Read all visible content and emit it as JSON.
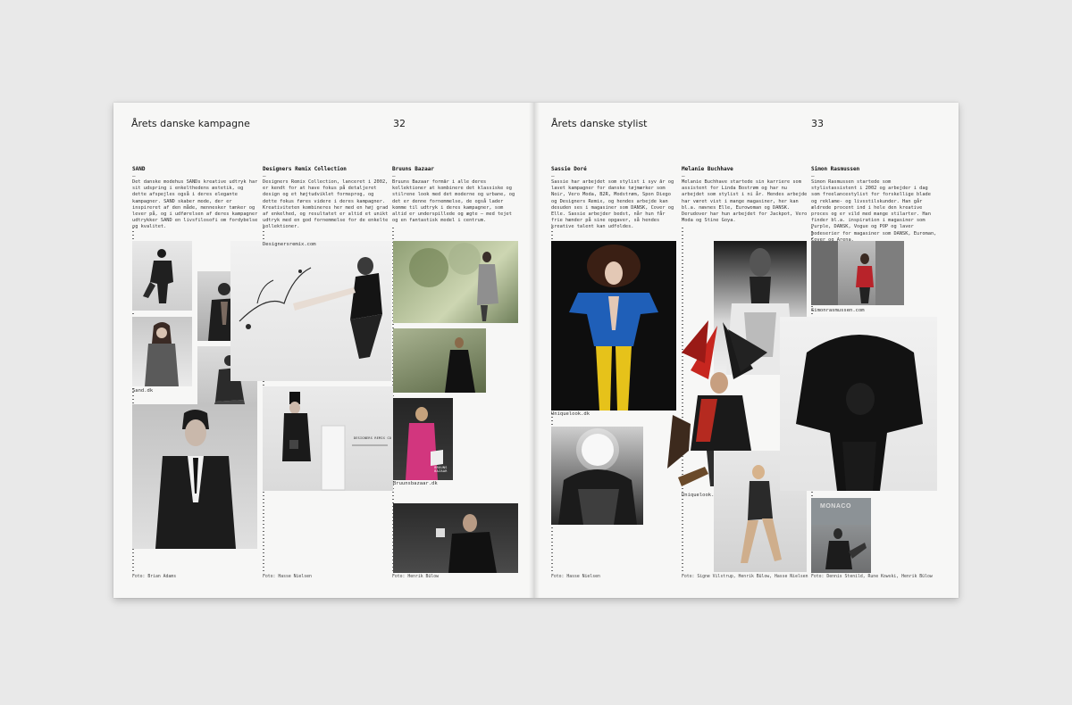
{
  "left_page": {
    "title": "Årets danske kampagne",
    "number": "32",
    "columns": [
      {
        "heading": "SAND",
        "body": "Det danske modehus SANDs kreative udtryk har sit udspring i enkelthedens æstetik, og dette afspejles også i deres elegante kampagner. SAND skaber mode, der er inspireret af den måde, mennesker tænker og lever på, og i udførelsen af deres kampagner udtrykker SAND en livsfilosofi om fordybelse og kvalitet."
      },
      {
        "heading": "Designers Remix Collection",
        "body": "Designers Remix Collection, lanceret i 2002, er kendt for at have fokus på detaljeret design og et højtudviklet formsprog, og dette fokus føres videre i deres kampagner. Kreativiteten kombineres her med en høj grad af enkelhed, og resultatet er altid et unikt udtryk med en god fornemmelse for de enkelte kollektioner."
      },
      {
        "heading": "Bruuns Bazaar",
        "body": "Bruuns Bazaar formår i alle deres kollektioner at kombinere det klassiske og stilrene look med det moderne og urbane, og det er denne fornemmelse, de også lader komme til udtryk i deres kampagner, som altid er underspillede og ægte – med tejet og en fantastisk model i centrum."
      }
    ],
    "captions": {
      "sand": "Sand.dk",
      "remix": "Designersremix.com",
      "bruuns": "Bruunsbazaar.dk"
    },
    "credits": [
      "Foto: Brian Adams",
      "Foto: Hasse Nielsen",
      "Foto: Henrik Bülow"
    ],
    "logo_texts": {
      "remix_store": "DESIGNERS REMIX CO",
      "bruuns_logo": "BRUUNS BAZAAR"
    }
  },
  "right_page": {
    "title": "Årets danske stylist",
    "number": "33",
    "columns": [
      {
        "heading": "Sassie Doré",
        "body": "Sassie har arbejdet som stylist i syv år og lavet kampagner for danske tøjmærker som Noir, Vero Moda, B2R, Modstrøm, Spon Diego og Designers Remix, og hendes arbejde kan desuden ses i magasiner som DANSK, Cover og Elle. Sassie arbejder bedst, når hun får frie hænder på sine opgaver, så hendes kreative talent kan udfoldes."
      },
      {
        "heading": "Melanie Buchhave",
        "body": "Melanie Buchhave startede sin karriere som assistent for Linda Bostrøm og har nu arbejdet som stylist i ni år. Hendes arbejde har været vist i mange magasiner, her kan bl.a. nævnes Elle, Eurowoman og DANSK. Derudover har hun arbejdet for Jackpot, Vero Moda og Stine Goya."
      },
      {
        "heading": "Simon Rasmussen",
        "body": "Simon Rasmussen startede som stylistassistent i 2002 og arbejder i dag som freelancestylist for forskellige blade og reklame- og livsstilskunder. Han går ældrede procent ind i hele den kreative proces og er vild med mange stilarter. Han finder bl.a. inspiration i magasiner som Purple, DANSK, Vogue og POP og laver modeserier for magasiner som DANSK, Euroman, Cover og Arena."
      }
    ],
    "captions": {
      "sassie": "Uniquelook.dk",
      "melanie": "Uniquelook.dk",
      "simon": "Simonrasmussen.com"
    },
    "credits": [
      "Foto: Hasse Nielsen",
      "Foto: Signe Vilstrup, Henrik Bülow, Hasse Nielsen",
      "Foto: Dennis Stenild, Rune Kowski, Henrik Bülow"
    ],
    "sign_text": "MONACO"
  },
  "colors": {
    "paper": "#f7f7f6",
    "background": "#e9e9e9",
    "blue_bodysuit": "#1f5fb8",
    "yellow_tights": "#e6c21a",
    "pink_coat": "#d2367e",
    "red_feathers": "#c7261f"
  }
}
